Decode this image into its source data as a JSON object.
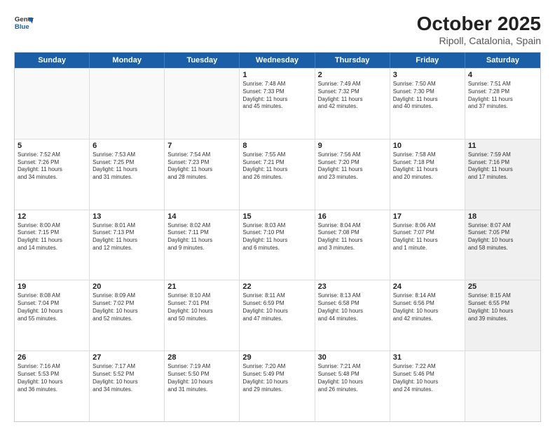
{
  "logo": {
    "general": "General",
    "blue": "Blue"
  },
  "title": "October 2025",
  "subtitle": "Ripoll, Catalonia, Spain",
  "weekdays": [
    "Sunday",
    "Monday",
    "Tuesday",
    "Wednesday",
    "Thursday",
    "Friday",
    "Saturday"
  ],
  "rows": [
    [
      {
        "day": "",
        "text": "",
        "empty": true
      },
      {
        "day": "",
        "text": "",
        "empty": true
      },
      {
        "day": "",
        "text": "",
        "empty": true
      },
      {
        "day": "1",
        "text": "Sunrise: 7:48 AM\nSunset: 7:33 PM\nDaylight: 11 hours\nand 45 minutes."
      },
      {
        "day": "2",
        "text": "Sunrise: 7:49 AM\nSunset: 7:32 PM\nDaylight: 11 hours\nand 42 minutes."
      },
      {
        "day": "3",
        "text": "Sunrise: 7:50 AM\nSunset: 7:30 PM\nDaylight: 11 hours\nand 40 minutes."
      },
      {
        "day": "4",
        "text": "Sunrise: 7:51 AM\nSunset: 7:28 PM\nDaylight: 11 hours\nand 37 minutes."
      }
    ],
    [
      {
        "day": "5",
        "text": "Sunrise: 7:52 AM\nSunset: 7:26 PM\nDaylight: 11 hours\nand 34 minutes."
      },
      {
        "day": "6",
        "text": "Sunrise: 7:53 AM\nSunset: 7:25 PM\nDaylight: 11 hours\nand 31 minutes."
      },
      {
        "day": "7",
        "text": "Sunrise: 7:54 AM\nSunset: 7:23 PM\nDaylight: 11 hours\nand 28 minutes."
      },
      {
        "day": "8",
        "text": "Sunrise: 7:55 AM\nSunset: 7:21 PM\nDaylight: 11 hours\nand 26 minutes."
      },
      {
        "day": "9",
        "text": "Sunrise: 7:56 AM\nSunset: 7:20 PM\nDaylight: 11 hours\nand 23 minutes."
      },
      {
        "day": "10",
        "text": "Sunrise: 7:58 AM\nSunset: 7:18 PM\nDaylight: 11 hours\nand 20 minutes."
      },
      {
        "day": "11",
        "text": "Sunrise: 7:59 AM\nSunset: 7:16 PM\nDaylight: 11 hours\nand 17 minutes.",
        "shaded": true
      }
    ],
    [
      {
        "day": "12",
        "text": "Sunrise: 8:00 AM\nSunset: 7:15 PM\nDaylight: 11 hours\nand 14 minutes."
      },
      {
        "day": "13",
        "text": "Sunrise: 8:01 AM\nSunset: 7:13 PM\nDaylight: 11 hours\nand 12 minutes."
      },
      {
        "day": "14",
        "text": "Sunrise: 8:02 AM\nSunset: 7:11 PM\nDaylight: 11 hours\nand 9 minutes."
      },
      {
        "day": "15",
        "text": "Sunrise: 8:03 AM\nSunset: 7:10 PM\nDaylight: 11 hours\nand 6 minutes."
      },
      {
        "day": "16",
        "text": "Sunrise: 8:04 AM\nSunset: 7:08 PM\nDaylight: 11 hours\nand 3 minutes."
      },
      {
        "day": "17",
        "text": "Sunrise: 8:06 AM\nSunset: 7:07 PM\nDaylight: 11 hours\nand 1 minute."
      },
      {
        "day": "18",
        "text": "Sunrise: 8:07 AM\nSunset: 7:05 PM\nDaylight: 10 hours\nand 58 minutes.",
        "shaded": true
      }
    ],
    [
      {
        "day": "19",
        "text": "Sunrise: 8:08 AM\nSunset: 7:04 PM\nDaylight: 10 hours\nand 55 minutes."
      },
      {
        "day": "20",
        "text": "Sunrise: 8:09 AM\nSunset: 7:02 PM\nDaylight: 10 hours\nand 52 minutes."
      },
      {
        "day": "21",
        "text": "Sunrise: 8:10 AM\nSunset: 7:01 PM\nDaylight: 10 hours\nand 50 minutes."
      },
      {
        "day": "22",
        "text": "Sunrise: 8:11 AM\nSunset: 6:59 PM\nDaylight: 10 hours\nand 47 minutes."
      },
      {
        "day": "23",
        "text": "Sunrise: 8:13 AM\nSunset: 6:58 PM\nDaylight: 10 hours\nand 44 minutes."
      },
      {
        "day": "24",
        "text": "Sunrise: 8:14 AM\nSunset: 6:56 PM\nDaylight: 10 hours\nand 42 minutes."
      },
      {
        "day": "25",
        "text": "Sunrise: 8:15 AM\nSunset: 6:55 PM\nDaylight: 10 hours\nand 39 minutes.",
        "shaded": true
      }
    ],
    [
      {
        "day": "26",
        "text": "Sunrise: 7:16 AM\nSunset: 5:53 PM\nDaylight: 10 hours\nand 36 minutes."
      },
      {
        "day": "27",
        "text": "Sunrise: 7:17 AM\nSunset: 5:52 PM\nDaylight: 10 hours\nand 34 minutes."
      },
      {
        "day": "28",
        "text": "Sunrise: 7:19 AM\nSunset: 5:50 PM\nDaylight: 10 hours\nand 31 minutes."
      },
      {
        "day": "29",
        "text": "Sunrise: 7:20 AM\nSunset: 5:49 PM\nDaylight: 10 hours\nand 29 minutes."
      },
      {
        "day": "30",
        "text": "Sunrise: 7:21 AM\nSunset: 5:48 PM\nDaylight: 10 hours\nand 26 minutes."
      },
      {
        "day": "31",
        "text": "Sunrise: 7:22 AM\nSunset: 5:46 PM\nDaylight: 10 hours\nand 24 minutes."
      },
      {
        "day": "",
        "text": "",
        "empty": true
      }
    ]
  ]
}
